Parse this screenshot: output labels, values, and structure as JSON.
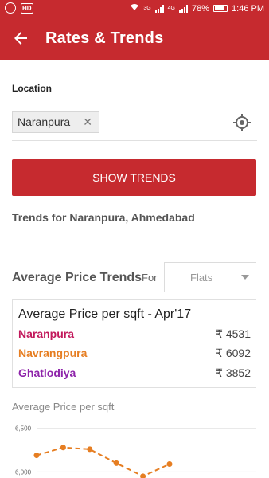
{
  "status_bar": {
    "battery": "78%",
    "time": "1:46 PM",
    "network_a": "3G",
    "network_b": "4G",
    "hd_label": "HD"
  },
  "appbar": {
    "title": "Rates & Trends"
  },
  "location": {
    "label": "Location",
    "chip": "Naranpura"
  },
  "show_button": "SHOW TRENDS",
  "trends_for": "Trends for Naranpura, Ahmedabad",
  "average_section": {
    "title": "Average Price Trends",
    "for_label": "For",
    "property_type": "Flats"
  },
  "price_card": {
    "title": "Average Price per sqft - Apr'17",
    "rows": [
      {
        "name": "Naranpura",
        "price": "₹ 4531",
        "color": "#c2185b"
      },
      {
        "name": "Navrangpura",
        "price": "₹ 6092",
        "color": "#e67e22"
      },
      {
        "name": "Ghatlodiya",
        "price": "₹ 3852",
        "color": "#8e24aa"
      }
    ]
  },
  "chart": {
    "label": "Average Price per sqft"
  },
  "chart_data": {
    "type": "line",
    "ylabel": "Average Price per sqft",
    "y_ticks": [
      "6,500",
      "6,000"
    ],
    "ylim": [
      5930,
      6570
    ],
    "grid": true,
    "series": [
      {
        "values": [
          6190,
          6280,
          6260,
          6100,
          5950,
          6090
        ],
        "color": "#e67e22"
      }
    ]
  }
}
